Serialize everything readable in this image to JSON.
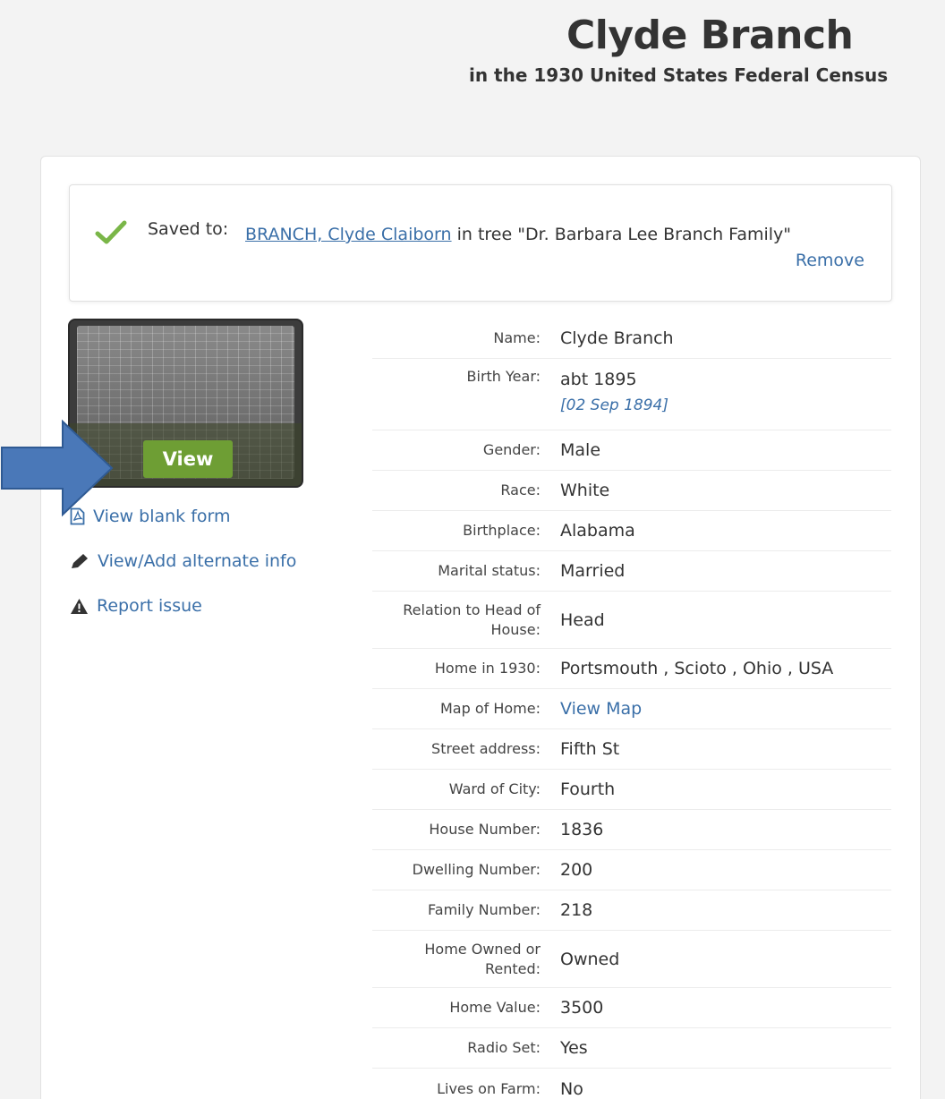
{
  "header": {
    "title": "Clyde Branch",
    "subtitle": "in the 1930 United States Federal Census"
  },
  "saved": {
    "prefix": "Saved to:",
    "person_link": "BRANCH, Clyde Claiborn",
    "tree_text": " in tree \"Dr. Barbara Lee Branch Family\"",
    "remove_label": "Remove"
  },
  "image_panel": {
    "view_button": "View"
  },
  "side_links": {
    "blank_form": "View blank form",
    "alternate_info": "View/Add alternate info",
    "report_issue": "Report issue"
  },
  "details": {
    "name_label": "Name:",
    "name_value": "Clyde Branch",
    "birth_year_label": "Birth Year:",
    "birth_year_value": "abt 1895",
    "birth_year_alt": "[02 Sep 1894]",
    "gender_label": "Gender:",
    "gender_value": "Male",
    "race_label": "Race:",
    "race_value": "White",
    "birthplace_label": "Birthplace:",
    "birthplace_value": "Alabama",
    "marital_label": "Marital status:",
    "marital_value": "Married",
    "relation_label": "Relation to Head of House:",
    "relation_value": "Head",
    "home_label": "Home in 1930:",
    "home_value": "Portsmouth , Scioto , Ohio , USA",
    "map_label": "Map of Home:",
    "map_value": "View Map",
    "street_label": "Street address:",
    "street_value": "Fifth St",
    "ward_label": "Ward of City:",
    "ward_value": "Fourth",
    "house_number_label": "House Number:",
    "house_number_value": "1836",
    "dwelling_label": "Dwelling Number:",
    "dwelling_value": "200",
    "family_label": "Family Number:",
    "family_value": "218",
    "owned_label": "Home Owned or Rented:",
    "owned_value": "Owned",
    "home_value_label": "Home Value:",
    "home_value_value": "3500",
    "radio_label": "Radio Set:",
    "radio_value": "Yes",
    "farm_label": "Lives on Farm:",
    "farm_value": "No"
  },
  "colors": {
    "link": "#3a6fa8",
    "view_button": "#6e9e34",
    "check": "#7ab648",
    "arrow": "#4a78b8"
  },
  "icons": {
    "check": "check-icon",
    "blank_form": "pdf-document-icon",
    "alternate_info": "pencil-icon",
    "report_issue": "warning-icon",
    "arrow": "arrow-right-icon"
  }
}
